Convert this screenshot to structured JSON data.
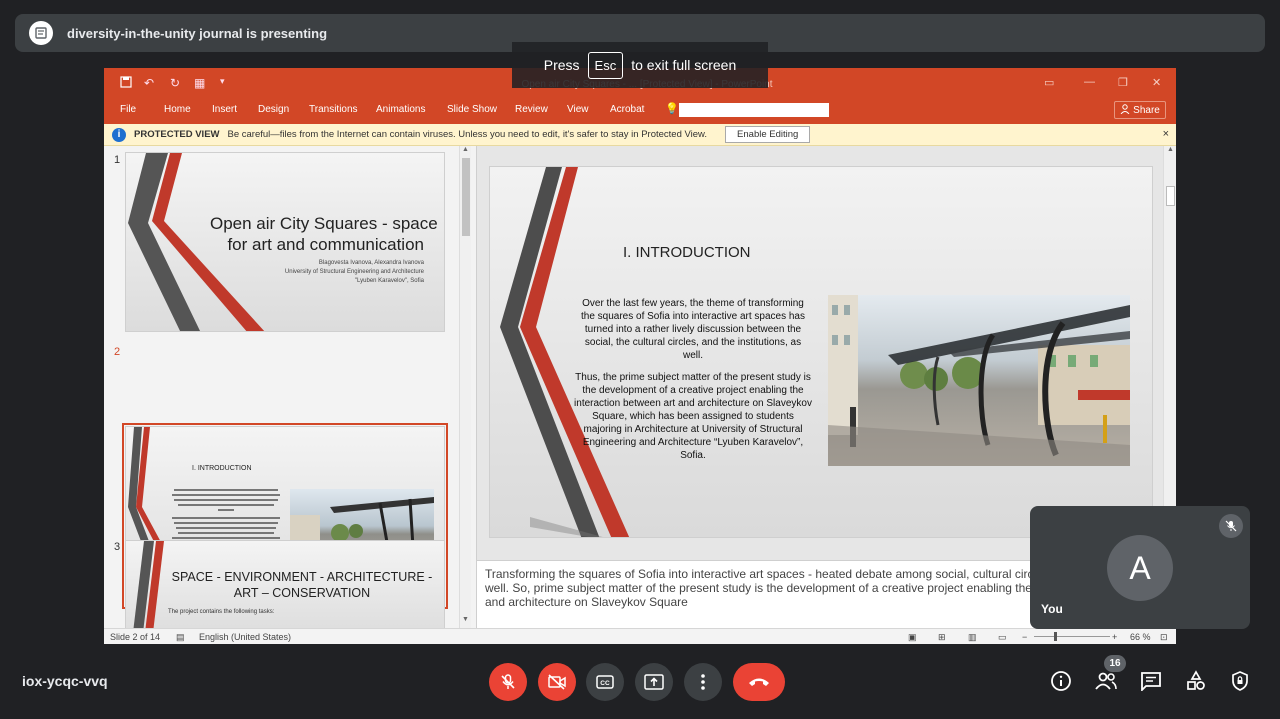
{
  "presenter": {
    "text": "diversity-in-the-unity journal is presenting"
  },
  "fullscreen_toast": {
    "press": "Press",
    "key": "Esc",
    "rest": "to exit full screen"
  },
  "ppt": {
    "window_title": "Open air City Squares - ... [Protected View] - PowerPoint",
    "tabs": [
      "File",
      "Home",
      "Insert",
      "Design",
      "Transitions",
      "Animations",
      "Slide Show",
      "Review",
      "View",
      "Acrobat"
    ],
    "share_label": "Share",
    "protected_view": {
      "label": "PROTECTED VIEW",
      "message": "Be careful—files from the Internet can contain viruses. Unless you need to edit, it's safer to stay in Protected View.",
      "button": "Enable Editing",
      "close": "×"
    },
    "thumbnails": [
      {
        "num": "1",
        "title_line1": "Open air City Squares - space",
        "title_line2": "for art and communication",
        "authors": "Blagovesta Ivanova, Alexandra Ivanova",
        "univ1": "University of Structural Engineering and Architecture",
        "univ2": "\"Lyuben Karavelov\", Sofia"
      },
      {
        "num": "2",
        "title": "I.    INTRODUCTION"
      },
      {
        "num": "3",
        "title_line1": "SPACE - ENVIRONMENT - ARCHITECTURE -",
        "title_line2": "ART – CONSERVATION",
        "body": "The project contains the following tasks:"
      }
    ],
    "slide": {
      "heading": "I.    INTRODUCTION",
      "para1": "Over the last few years, the theme of transforming the squares of Sofia into interactive art spaces has turned into a rather lively discussion between the social, the cultural circles, and the institutions, as well.",
      "para2": "Thus, the prime subject matter of the present study is the development of a creative project enabling the interaction between art and architecture on Slaveykov Square, which has been assigned to students majoring in Architecture at University of Structural Engineering and Architecture “Lyuben Karavelov”, Sofia."
    },
    "notes": "Transforming the squares of Sofia into interactive art spaces - heated debate among social, cultural circles, and institutions as well. So, prime subject matter of the present study is the development of a creative project enabling the interaction between art and architecture on Slaveykov Square",
    "status": {
      "slide": "Slide 2 of 14",
      "language": "English (United States)",
      "zoom": "66 %"
    }
  },
  "self_tile": {
    "initial": "A",
    "name": "You"
  },
  "meeting": {
    "code": "iox-ycqc-vvq",
    "participants": "16"
  },
  "colors": {
    "ppt_accent": "#d24726",
    "meet_red": "#ea4335",
    "meet_bg": "#202124"
  }
}
